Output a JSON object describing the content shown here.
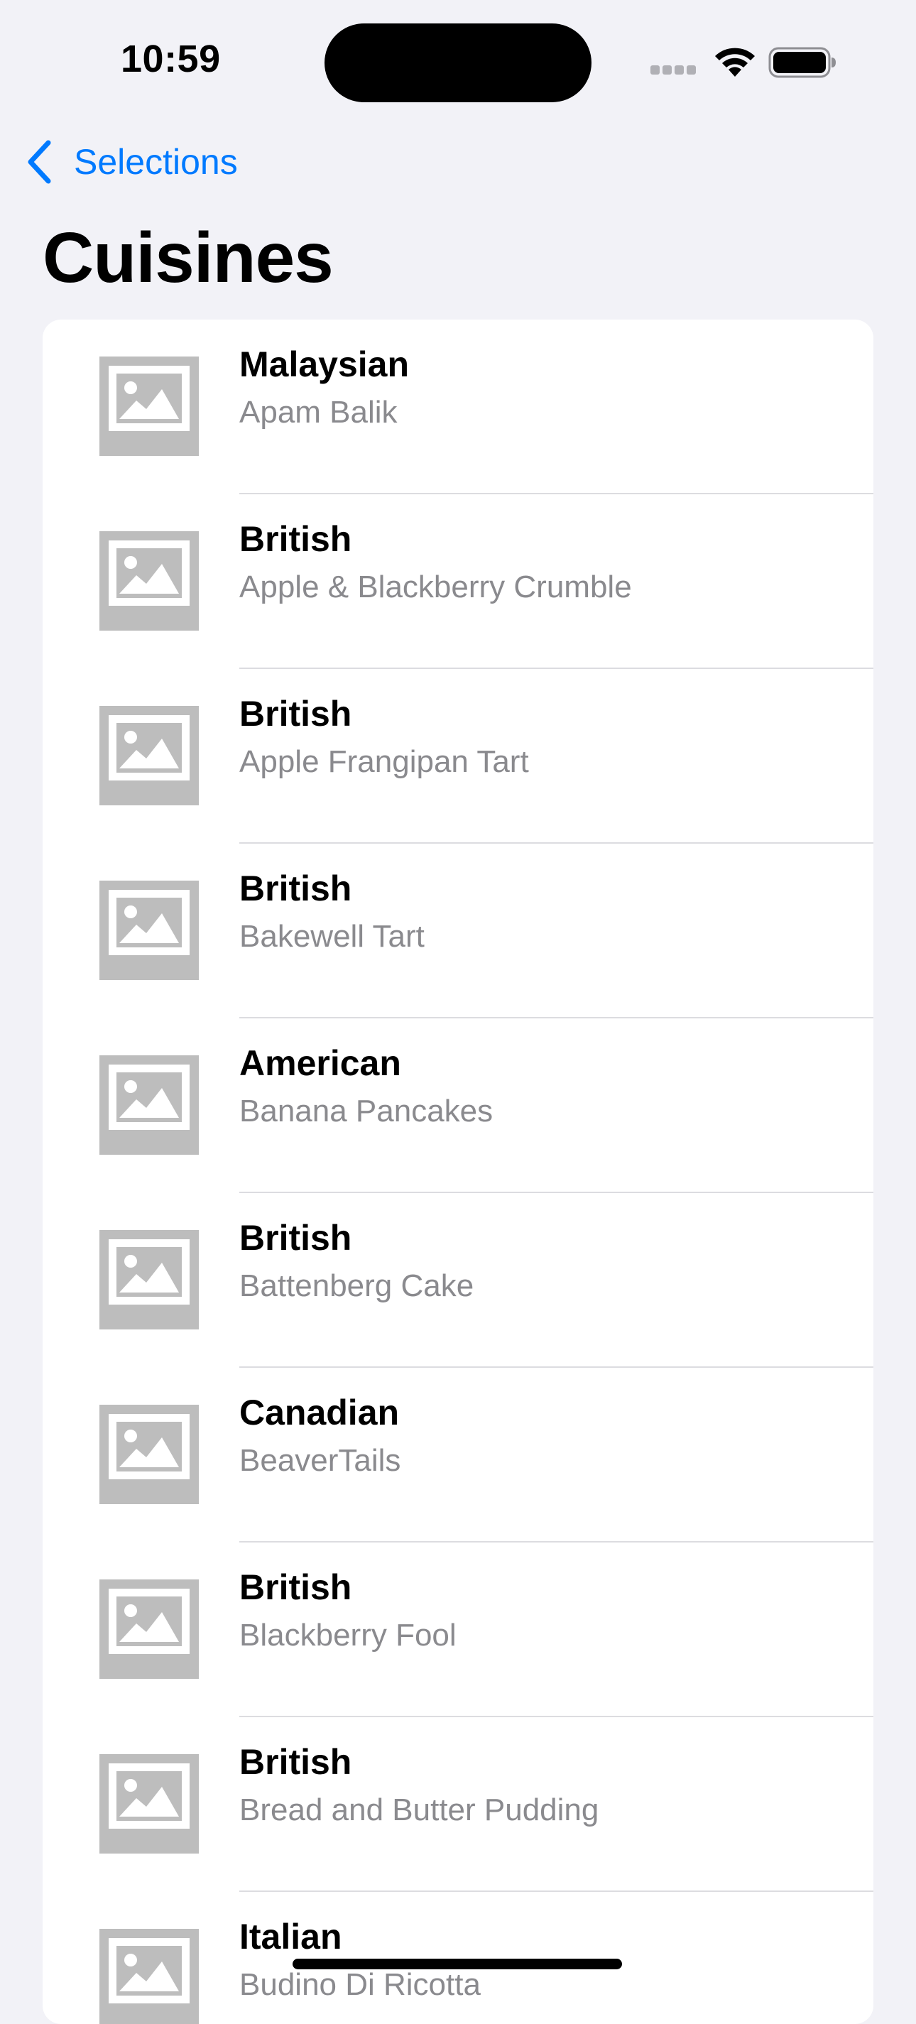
{
  "status_bar": {
    "time": "10:59",
    "icons": [
      "cellular-signal-icon",
      "wifi-icon",
      "battery-icon"
    ]
  },
  "nav": {
    "back_label": "Selections",
    "back_icon": "chevron-left-icon",
    "title": "Cuisines"
  },
  "colors": {
    "accent": "#007aff",
    "background": "#f2f2f7",
    "card": "#ffffff",
    "subtitle": "#8a8a8e",
    "placeholder": "#bdbdbd"
  },
  "items": [
    {
      "cuisine": "Malaysian",
      "dish": "Apam Balik",
      "icon": "photo-placeholder-icon"
    },
    {
      "cuisine": "British",
      "dish": "Apple & Blackberry Crumble",
      "icon": "photo-placeholder-icon"
    },
    {
      "cuisine": "British",
      "dish": "Apple Frangipan Tart",
      "icon": "photo-placeholder-icon"
    },
    {
      "cuisine": "British",
      "dish": "Bakewell Tart",
      "icon": "photo-placeholder-icon"
    },
    {
      "cuisine": "American",
      "dish": "Banana Pancakes",
      "icon": "photo-placeholder-icon"
    },
    {
      "cuisine": "British",
      "dish": "Battenberg Cake",
      "icon": "photo-placeholder-icon"
    },
    {
      "cuisine": "Canadian",
      "dish": "BeaverTails",
      "icon": "photo-placeholder-icon"
    },
    {
      "cuisine": "British",
      "dish": "Blackberry Fool",
      "icon": "photo-placeholder-icon"
    },
    {
      "cuisine": "British",
      "dish": "Bread and Butter Pudding",
      "icon": "photo-placeholder-icon"
    },
    {
      "cuisine": "Italian",
      "dish": "Budino Di Ricotta",
      "icon": "photo-placeholder-icon"
    }
  ]
}
